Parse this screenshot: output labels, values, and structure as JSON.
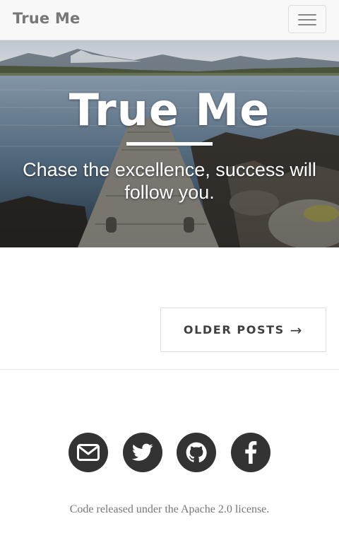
{
  "navbar": {
    "brand": "True Me",
    "toggle_icon": "hamburger-menu-icon"
  },
  "hero": {
    "title": "True Me",
    "subtitle": "Chase the excellence, success will follow you.",
    "background": "lake-pier-photo"
  },
  "pager": {
    "older_label": "OLDER POSTS",
    "older_arrow": "→"
  },
  "footer": {
    "social": [
      {
        "name": "email",
        "icon": "envelope-icon"
      },
      {
        "name": "twitter",
        "icon": "twitter-icon"
      },
      {
        "name": "github",
        "icon": "github-icon"
      },
      {
        "name": "facebook",
        "icon": "facebook-icon"
      }
    ],
    "copyright": "Code released under the Apache 2.0 license."
  },
  "colors": {
    "navbar_bg": "#f8f8f8",
    "brand_text": "#777777",
    "social_circle": "#333333",
    "button_text": "#404040"
  }
}
